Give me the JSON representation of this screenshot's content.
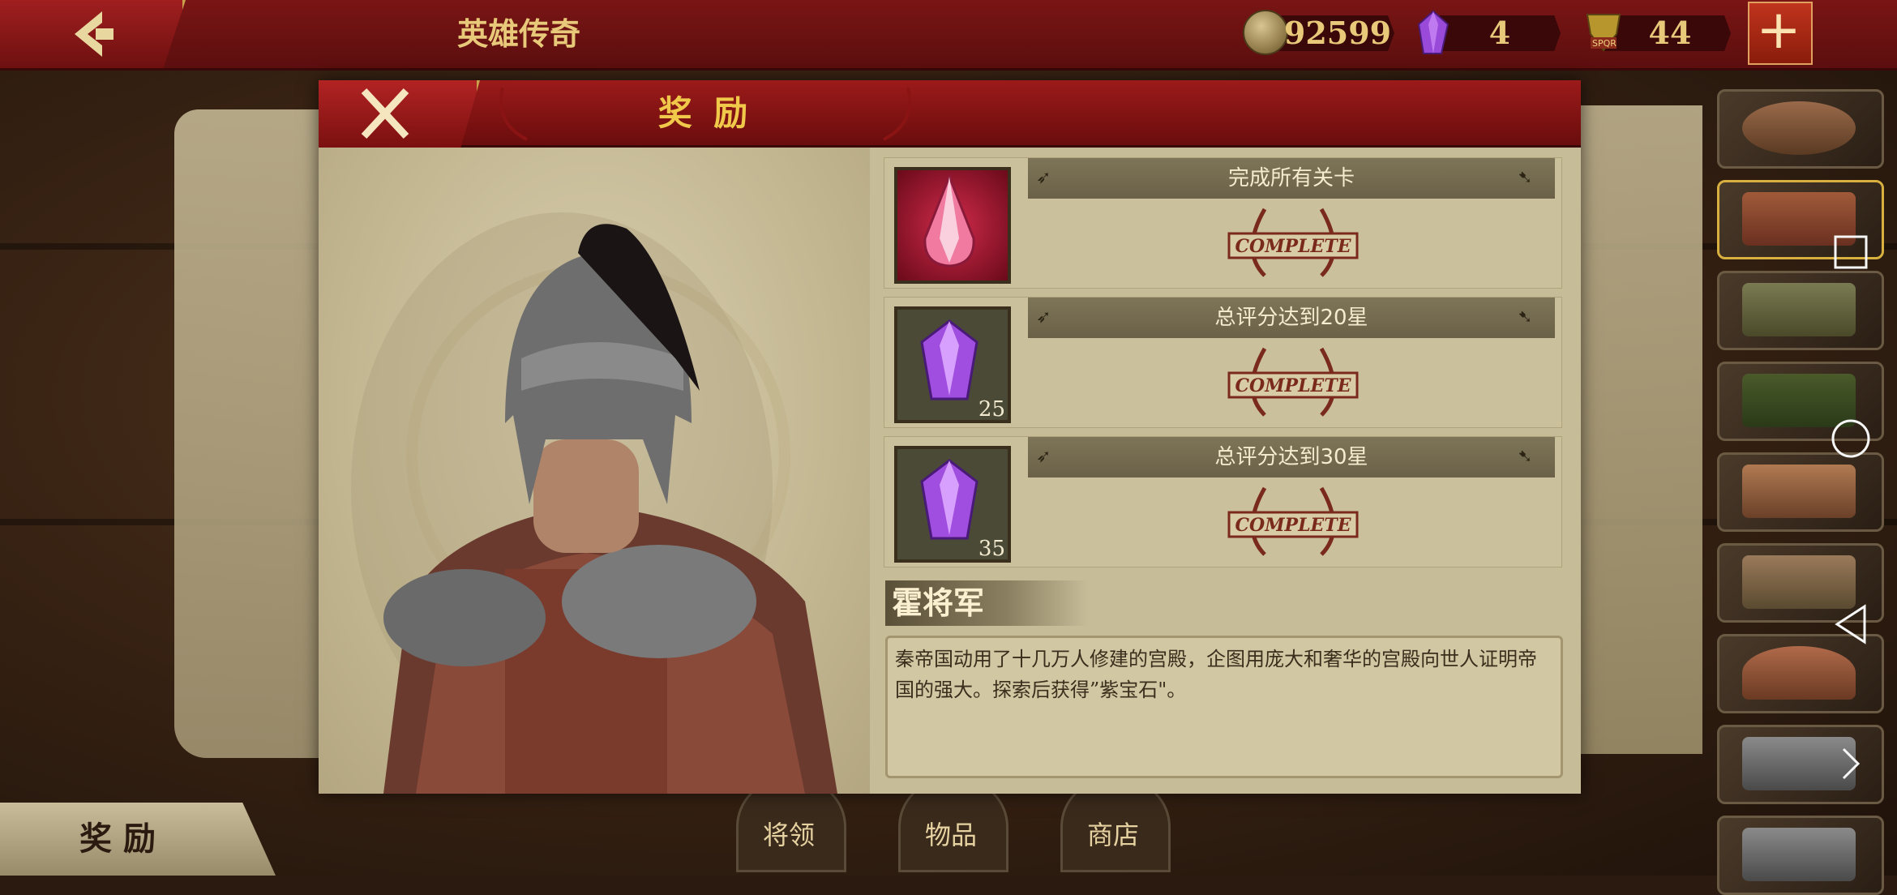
{
  "topbar": {
    "title": "英雄传奇",
    "coins": "92599",
    "gems": "4",
    "spqr": "44",
    "spqr_label": "SPQR"
  },
  "modal": {
    "title": "奖 励",
    "rewards": [
      {
        "title": "完成所有关卡",
        "count": "",
        "item": "red-crystal-icon",
        "status": "COMPLETE"
      },
      {
        "title": "总评分达到20星",
        "count": "25",
        "item": "purple-gem-icon",
        "status": "COMPLETE"
      },
      {
        "title": "总评分达到30星",
        "count": "35",
        "item": "purple-gem-icon",
        "status": "COMPLETE"
      }
    ],
    "hero": {
      "name": "霍将军",
      "description": "秦帝国动用了十几万人修建的宫殿，企图用庞大和奢华的宫殿向世人证明帝国的强大。探索后获得”紫宝石\"。"
    }
  },
  "bottom": {
    "reward_tab": "奖 励",
    "tabs": [
      "将领",
      "物品",
      "商店"
    ]
  },
  "colors": {
    "topbar": "#6a0d0d",
    "accent_gold": "#f0c84a",
    "panel": "#c7bc98",
    "stamp": "#7a2a1c"
  }
}
